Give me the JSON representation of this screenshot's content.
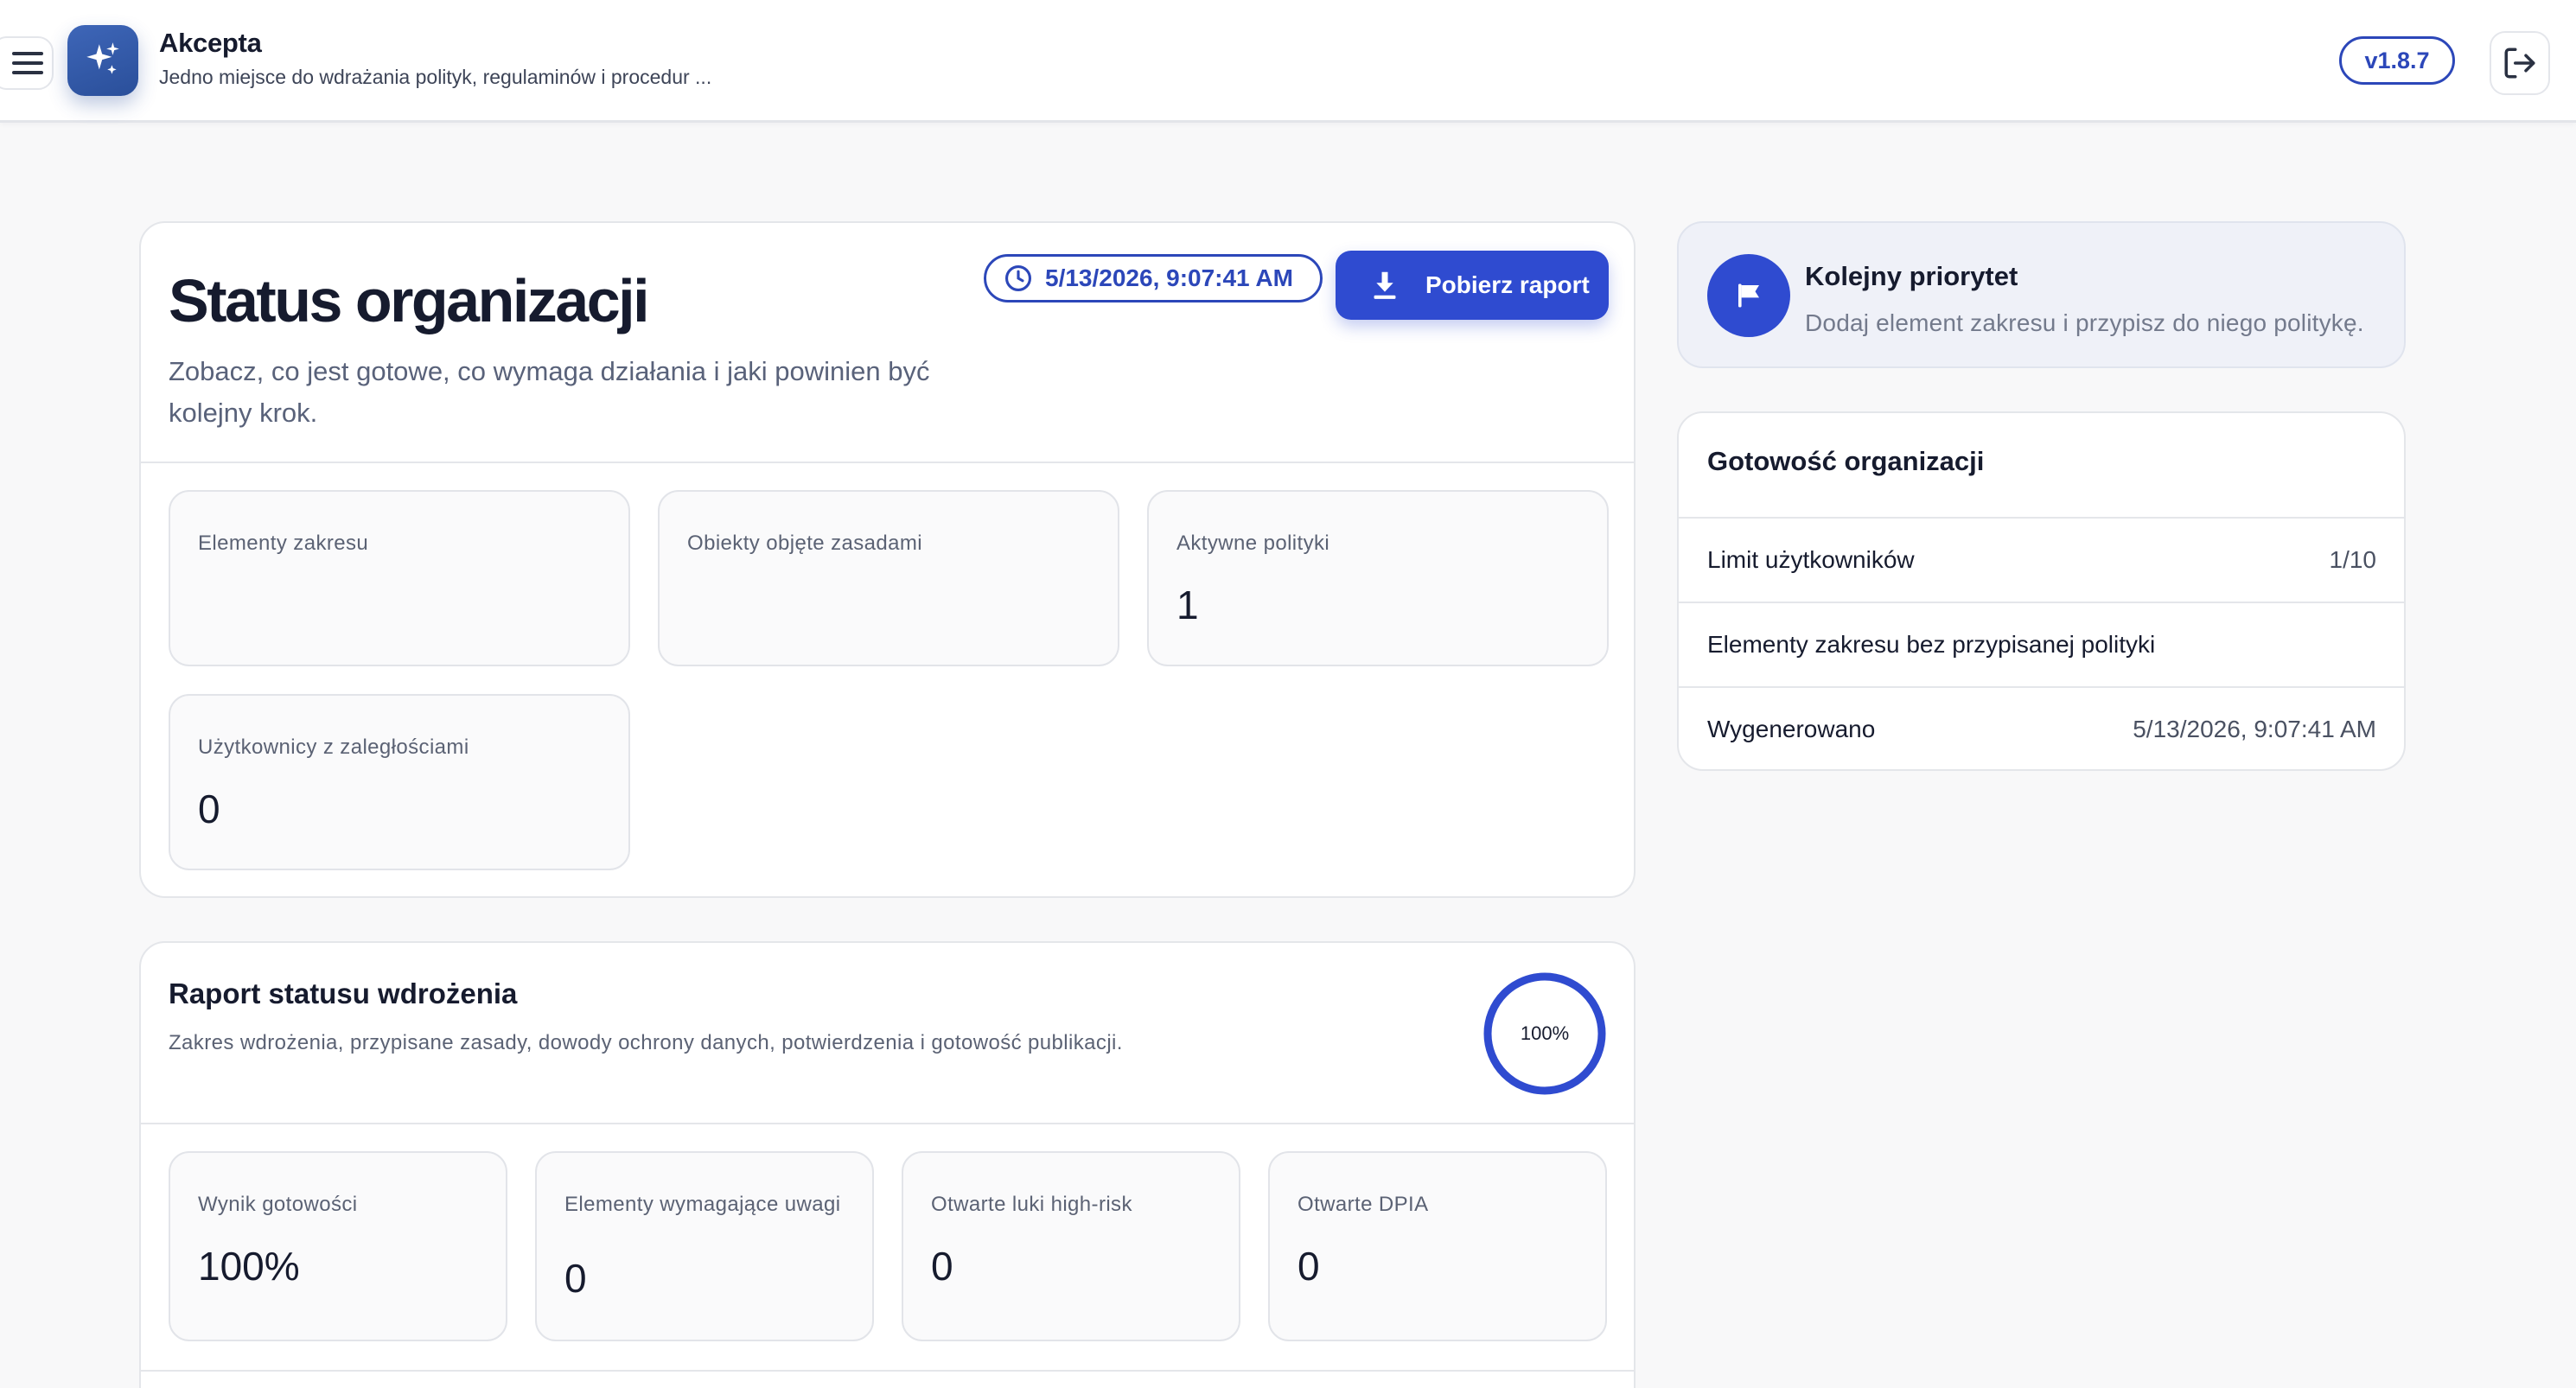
{
  "header": {
    "app_title": "Akcepta",
    "app_subtitle": "Jedno miejsce do wdrażania polityk, regulaminów i procedur ...",
    "version": "v1.8.7",
    "icons": {
      "menu": "hamburger-menu-icon",
      "logo": "sparkles-icon",
      "logout": "logout-icon"
    }
  },
  "status": {
    "title": "Status organizacji",
    "description": "Zobacz, co jest gotowe, co wymaga działania i jaki powinien być kolejny krok.",
    "timestamp": "5/13/2026, 9:07:41 AM",
    "download_label": "Pobierz raport",
    "stats": [
      {
        "label": "Elementy zakresu",
        "value": ""
      },
      {
        "label": "Obiekty objęte zasadami",
        "value": ""
      },
      {
        "label": "Aktywne polityki",
        "value": "1"
      },
      {
        "label": "Użytkownicy z zaległościami",
        "value": "0"
      }
    ]
  },
  "priority": {
    "title": "Kolejny priorytet",
    "description": "Dodaj element zakresu i przypisz do niego politykę."
  },
  "readiness": {
    "title": "Gotowość organizacji",
    "rows": [
      {
        "label": "Limit użytkowników",
        "value": "1/10"
      },
      {
        "label": "Elementy zakresu bez przypisanej polityki",
        "value": ""
      },
      {
        "label": "Wygenerowano",
        "value": "5/13/2026, 9:07:41 AM"
      }
    ]
  },
  "report": {
    "title": "Raport statusu wdrożenia",
    "description": "Zakres wdrożenia, przypisane zasady, dowody ochrony danych, potwierdzenia i gotowość publikacji.",
    "progress_label": "100%",
    "progress_fraction": 1.0,
    "stats": [
      {
        "label": "Wynik gotowości",
        "value": "100%"
      },
      {
        "label": "Elementy wymagające uwagi",
        "value": "0"
      },
      {
        "label": "Otwarte luki high-risk",
        "value": "0"
      },
      {
        "label": "Otwarte DPIA",
        "value": "0"
      }
    ]
  },
  "colors": {
    "accent": "#2f4bd0",
    "accent_outline": "#2c47b9",
    "logo": "#2a4f9a",
    "text": "#161b2e",
    "muted": "#59627a",
    "background": "#f8f8f9"
  }
}
